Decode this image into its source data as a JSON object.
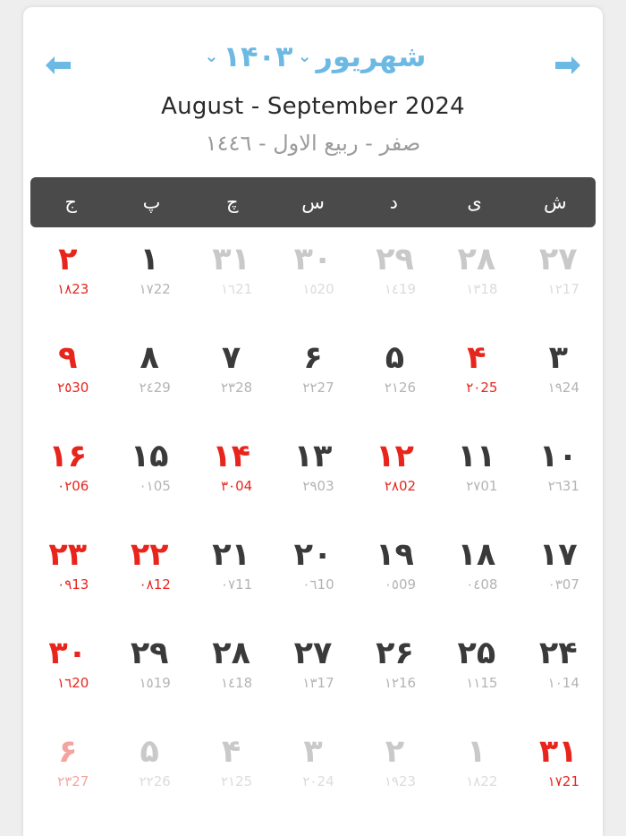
{
  "colors": {
    "accent": "#6cb9e3",
    "holiday": "#e8251c",
    "weekday_bar": "#4a4a4a",
    "normal_day": "#3a3a3a",
    "other_month": "#c9c9c9",
    "sub_text": "#b4b4b4",
    "card_bg": "#ffffff",
    "page_bg": "#eeeeee"
  },
  "header": {
    "prev_label": "←",
    "next_label": "→",
    "month_name": "شهریور",
    "year": "۱۴۰۳",
    "chevron": "⌄",
    "gregorian_range": "August - September 2024",
    "hijri_range": "صفر - ربیع الاول - ١٤٤٦"
  },
  "weekdays": [
    {
      "label": "ش",
      "full": "shanbe"
    },
    {
      "label": "ی",
      "full": "yekshanbe"
    },
    {
      "label": "د",
      "full": "doshanbe"
    },
    {
      "label": "س",
      "full": "seshanbe"
    },
    {
      "label": "چ",
      "full": "chaharshanbe"
    },
    {
      "label": "پ",
      "full": "panjshanbe"
    },
    {
      "label": "ج",
      "full": "jome"
    }
  ],
  "weeks": [
    [
      {
        "day": "۲۷",
        "hijri": "١٢",
        "greg": "17",
        "other": true,
        "holiday": false
      },
      {
        "day": "۲۸",
        "hijri": "١٣",
        "greg": "18",
        "other": true,
        "holiday": false
      },
      {
        "day": "۲۹",
        "hijri": "١٤",
        "greg": "19",
        "other": true,
        "holiday": false
      },
      {
        "day": "۳۰",
        "hijri": "١٥",
        "greg": "20",
        "other": true,
        "holiday": false
      },
      {
        "day": "۳۱",
        "hijri": "١٦",
        "greg": "21",
        "other": true,
        "holiday": false
      },
      {
        "day": "۱",
        "hijri": "١٧",
        "greg": "22",
        "other": false,
        "holiday": false
      },
      {
        "day": "۲",
        "hijri": "١٨",
        "greg": "23",
        "other": false,
        "holiday": true
      }
    ],
    [
      {
        "day": "۳",
        "hijri": "١٩",
        "greg": "24",
        "other": false,
        "holiday": false
      },
      {
        "day": "۴",
        "hijri": "٢٠",
        "greg": "25",
        "other": false,
        "holiday": true
      },
      {
        "day": "۵",
        "hijri": "٢١",
        "greg": "26",
        "other": false,
        "holiday": false
      },
      {
        "day": "۶",
        "hijri": "٢٢",
        "greg": "27",
        "other": false,
        "holiday": false
      },
      {
        "day": "۷",
        "hijri": "٢٣",
        "greg": "28",
        "other": false,
        "holiday": false
      },
      {
        "day": "۸",
        "hijri": "٢٤",
        "greg": "29",
        "other": false,
        "holiday": false
      },
      {
        "day": "۹",
        "hijri": "٢٥",
        "greg": "30",
        "other": false,
        "holiday": true
      }
    ],
    [
      {
        "day": "۱۰",
        "hijri": "٢٦",
        "greg": "31",
        "other": false,
        "holiday": false
      },
      {
        "day": "۱۱",
        "hijri": "٢٧",
        "greg": "01",
        "other": false,
        "holiday": false
      },
      {
        "day": "۱۲",
        "hijri": "٢٨",
        "greg": "02",
        "other": false,
        "holiday": true
      },
      {
        "day": "۱۳",
        "hijri": "٢٩",
        "greg": "03",
        "other": false,
        "holiday": false
      },
      {
        "day": "۱۴",
        "hijri": "٣٠",
        "greg": "04",
        "other": false,
        "holiday": true
      },
      {
        "day": "۱۵",
        "hijri": "٠١",
        "greg": "05",
        "other": false,
        "holiday": false
      },
      {
        "day": "۱۶",
        "hijri": "٠٢",
        "greg": "06",
        "other": false,
        "holiday": true
      }
    ],
    [
      {
        "day": "۱۷",
        "hijri": "٠٣",
        "greg": "07",
        "other": false,
        "holiday": false
      },
      {
        "day": "۱۸",
        "hijri": "٠٤",
        "greg": "08",
        "other": false,
        "holiday": false
      },
      {
        "day": "۱۹",
        "hijri": "٠٥",
        "greg": "09",
        "other": false,
        "holiday": false
      },
      {
        "day": "۲۰",
        "hijri": "٠٦",
        "greg": "10",
        "other": false,
        "holiday": false
      },
      {
        "day": "۲۱",
        "hijri": "٠٧",
        "greg": "11",
        "other": false,
        "holiday": false
      },
      {
        "day": "۲۲",
        "hijri": "٠٨",
        "greg": "12",
        "other": false,
        "holiday": true
      },
      {
        "day": "۲۳",
        "hijri": "٠٩",
        "greg": "13",
        "other": false,
        "holiday": true
      }
    ],
    [
      {
        "day": "۲۴",
        "hijri": "١٠",
        "greg": "14",
        "other": false,
        "holiday": false
      },
      {
        "day": "۲۵",
        "hijri": "١١",
        "greg": "15",
        "other": false,
        "holiday": false
      },
      {
        "day": "۲۶",
        "hijri": "١٢",
        "greg": "16",
        "other": false,
        "holiday": false
      },
      {
        "day": "۲۷",
        "hijri": "١٣",
        "greg": "17",
        "other": false,
        "holiday": false
      },
      {
        "day": "۲۸",
        "hijri": "١٤",
        "greg": "18",
        "other": false,
        "holiday": false
      },
      {
        "day": "۲۹",
        "hijri": "١٥",
        "greg": "19",
        "other": false,
        "holiday": false
      },
      {
        "day": "۳۰",
        "hijri": "١٦",
        "greg": "20",
        "other": false,
        "holiday": true
      }
    ],
    [
      {
        "day": "۳۱",
        "hijri": "١٧",
        "greg": "21",
        "other": false,
        "holiday": true
      },
      {
        "day": "۱",
        "hijri": "١٨",
        "greg": "22",
        "other": true,
        "holiday": false
      },
      {
        "day": "۲",
        "hijri": "١٩",
        "greg": "23",
        "other": true,
        "holiday": false
      },
      {
        "day": "۳",
        "hijri": "٢٠",
        "greg": "24",
        "other": true,
        "holiday": false
      },
      {
        "day": "۴",
        "hijri": "٢١",
        "greg": "25",
        "other": true,
        "holiday": false
      },
      {
        "day": "۵",
        "hijri": "٢٢",
        "greg": "26",
        "other": true,
        "holiday": false
      },
      {
        "day": "۶",
        "hijri": "٢٣",
        "greg": "27",
        "other": true,
        "holiday": true
      }
    ]
  ]
}
